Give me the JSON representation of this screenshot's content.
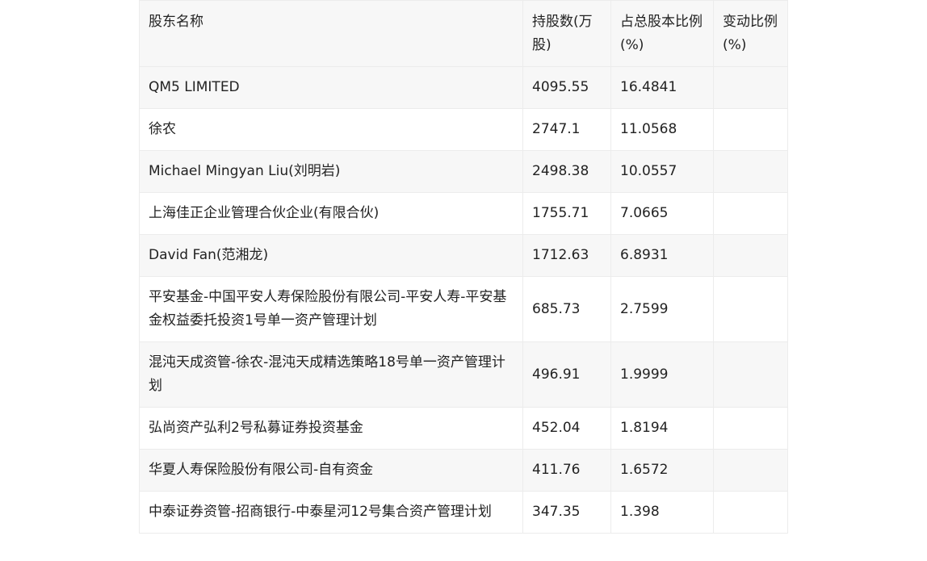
{
  "table": {
    "headers": [
      "股东名称",
      "持股数(万股)",
      "占总股本比例(%)",
      "变动比例(%)"
    ],
    "rows": [
      {
        "name": "QM5 LIMITED",
        "shares": "4095.55",
        "ratio": "16.4841",
        "change": ""
      },
      {
        "name": "徐农",
        "shares": "2747.1",
        "ratio": "11.0568",
        "change": ""
      },
      {
        "name": "Michael Mingyan Liu(刘明岩)",
        "shares": "2498.38",
        "ratio": "10.0557",
        "change": ""
      },
      {
        "name": "上海佳正企业管理合伙企业(有限合伙)",
        "shares": "1755.71",
        "ratio": "7.0665",
        "change": ""
      },
      {
        "name": "David Fan(范湘龙)",
        "shares": "1712.63",
        "ratio": "6.8931",
        "change": ""
      },
      {
        "name": "平安基金-中国平安人寿保险股份有限公司-平安人寿-平安基金权益委托投资1号单一资产管理计划",
        "shares": "685.73",
        "ratio": "2.7599",
        "change": ""
      },
      {
        "name": "混沌天成资管-徐农-混沌天成精选策略18号单一资产管理计划",
        "shares": "496.91",
        "ratio": "1.9999",
        "change": ""
      },
      {
        "name": "弘尚资产弘利2号私募证券投资基金",
        "shares": "452.04",
        "ratio": "1.8194",
        "change": ""
      },
      {
        "name": "华夏人寿保险股份有限公司-自有资金",
        "shares": "411.76",
        "ratio": "1.6572",
        "change": ""
      },
      {
        "name": "中泰证券资管-招商银行-中泰星河12号集合资产管理计划",
        "shares": "347.35",
        "ratio": "1.398",
        "change": ""
      }
    ]
  }
}
